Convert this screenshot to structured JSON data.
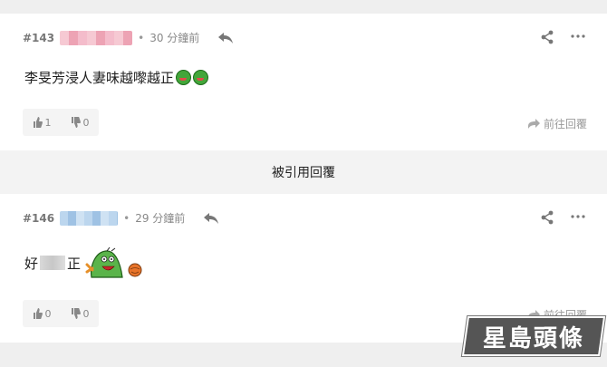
{
  "posts": [
    {
      "floor": "#143",
      "time": "30 分鐘前",
      "content": "李旻芳浸人妻味越嚟越正",
      "upvotes": "1",
      "downvotes": "0",
      "goto_label": "前往回覆",
      "username_color": "#eda3b4"
    },
    {
      "floor": "#146",
      "time": "29 分鐘前",
      "content_prefix": "好",
      "content_suffix": "正",
      "upvotes": "0",
      "downvotes": "0",
      "goto_label": "前往回覆",
      "username_color": "#9fc2e4"
    }
  ],
  "quote_label": "被引用回覆",
  "separator": "•",
  "logo_text": "星島頭條"
}
